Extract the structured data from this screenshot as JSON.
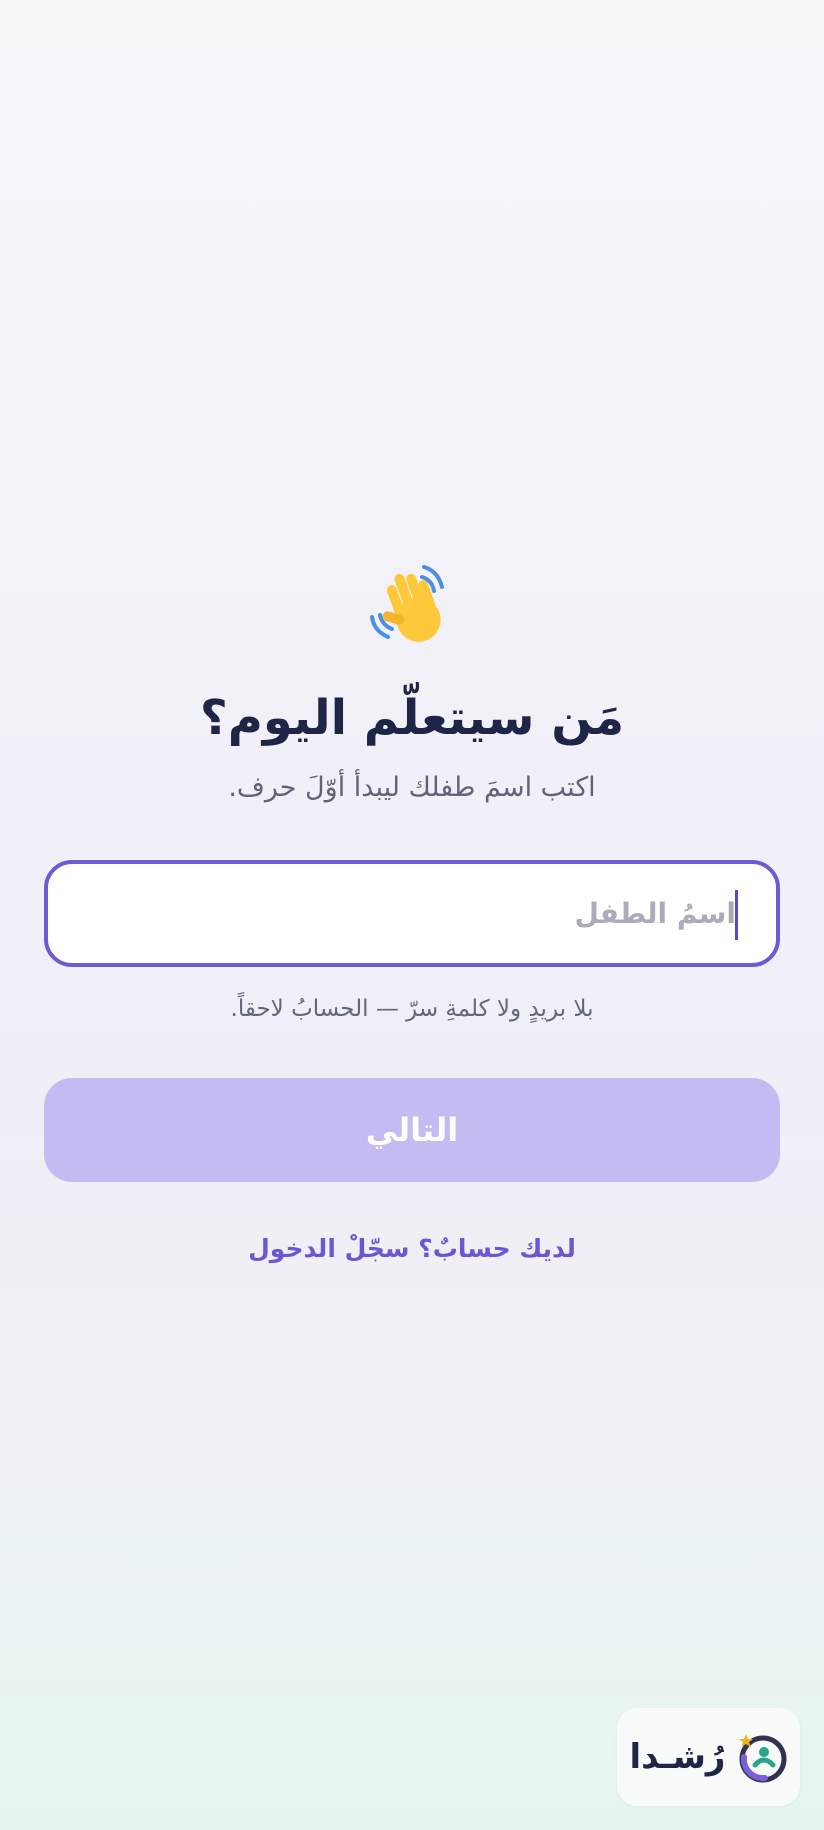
{
  "greeting": {
    "emoji": "👋",
    "emoji_icon": "waving-hand-icon"
  },
  "title": "مَن سيتعلّم اليوم؟",
  "subtitle": "اكتب اسمَ طفلك ليبدأ أوّلَ حرف.",
  "name_input": {
    "placeholder": "اسمُ الطفل",
    "value": ""
  },
  "hint": "بلا بريدٍ ولا كلمةِ سرّ — الحسابُ لاحقاً.",
  "next_button": {
    "label": "التالي"
  },
  "login_link": {
    "label": "لديك حسابٌ؟ سجّلْ الدخول"
  },
  "brand": {
    "name": "رُشـدا",
    "logo_icon": "rushda-logo-icon"
  },
  "colors": {
    "accent": "#6b5bd6",
    "button_disabled": "#c2bcf2",
    "link": "#6b56d3",
    "title": "#1f2547",
    "logo_teal": "#2aa58b",
    "logo_purple": "#7a5fd8",
    "logo_star": "#f2b21b"
  }
}
